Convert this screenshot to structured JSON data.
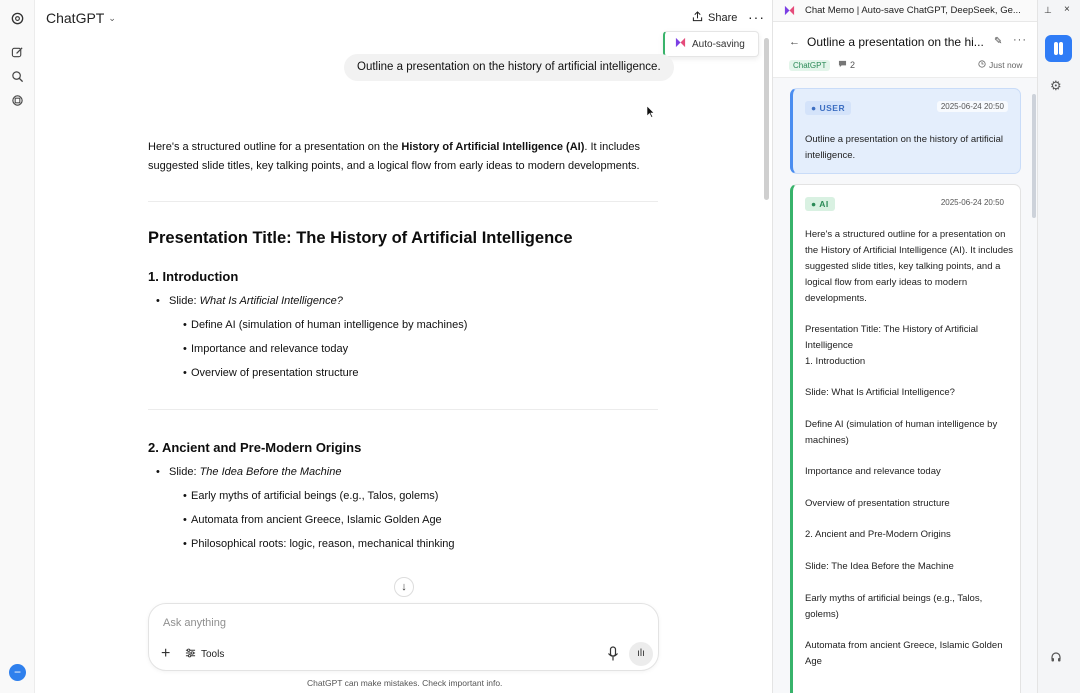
{
  "main": {
    "app_title": "ChatGPT",
    "share_label": "Share",
    "autosave_label": "Auto-saving",
    "user_message": "Outline a presentation on the history of artificial intelligence.",
    "intro_text_a": "Here's a structured outline for a presentation on the ",
    "intro_text_bold": "History of Artificial Intelligence (AI)",
    "intro_text_b": ". It includes suggested slide titles, key talking points, and a logical flow from early ideas to modern developments.",
    "heading": "Presentation Title: The History of Artificial Intelligence",
    "sections": [
      {
        "title": "1. Introduction",
        "slide_prefix": "Slide: ",
        "slide_title": "What Is Artificial Intelligence?",
        "points": [
          "Define AI (simulation of human intelligence by machines)",
          "Importance and relevance today",
          "Overview of presentation structure"
        ]
      },
      {
        "title": "2. Ancient and Pre-Modern Origins",
        "slide_prefix": "Slide: ",
        "slide_title": "The Idea Before the Machine",
        "points": [
          "Early myths of artificial beings (e.g., Talos, golems)",
          "Automata from ancient Greece, Islamic Golden Age",
          "Philosophical roots: logic, reason, mechanical thinking"
        ]
      }
    ],
    "composer_placeholder": "Ask anything",
    "tools_label": "Tools",
    "disclaimer": "ChatGPT can make mistakes. Check important info."
  },
  "panel": {
    "ext_title": "Chat Memo | Auto-save ChatGPT, DeepSeek, Ge...",
    "chat_title": "Outline a presentation on the hi...",
    "platform_tag": "ChatGPT",
    "comment_count": "2",
    "saved_time": "Just now",
    "user_card": {
      "role": "USER",
      "timestamp": "2025-06-24 20:50",
      "text": "Outline a presentation on the history of artificial intelligence."
    },
    "ai_card": {
      "role": "AI",
      "timestamp": "2025-06-24 20:50",
      "lines": [
        "Here's a structured outline for a presentation on the History of Artificial Intelligence (AI). It includes suggested slide titles, key talking points, and a logical flow from early ideas to modern developments.",
        "Presentation Title: The History of Artificial Intelligence",
        "1. Introduction",
        "Slide: What Is Artificial Intelligence?",
        "Define AI (simulation of human intelligence by machines)",
        "Importance and relevance today",
        "Overview of presentation structure",
        "2. Ancient and Pre-Modern Origins",
        "Slide: The Idea Before the Machine",
        "Early myths of artificial beings (e.g., Talos, golems)",
        "Automata from ancient Greece, Islamic Golden Age"
      ]
    }
  },
  "icons": {
    "rail": [
      "openai-logo-icon",
      "new-chat-icon",
      "search-icon",
      "library-icon"
    ],
    "toolbar": [
      "chat-memo-icon",
      "gear-icon",
      "help-icon"
    ]
  },
  "colors": {
    "accent_blue": "#2f7cf6",
    "save_green": "#38b36b",
    "user_card_bg": "#e4eefc"
  }
}
